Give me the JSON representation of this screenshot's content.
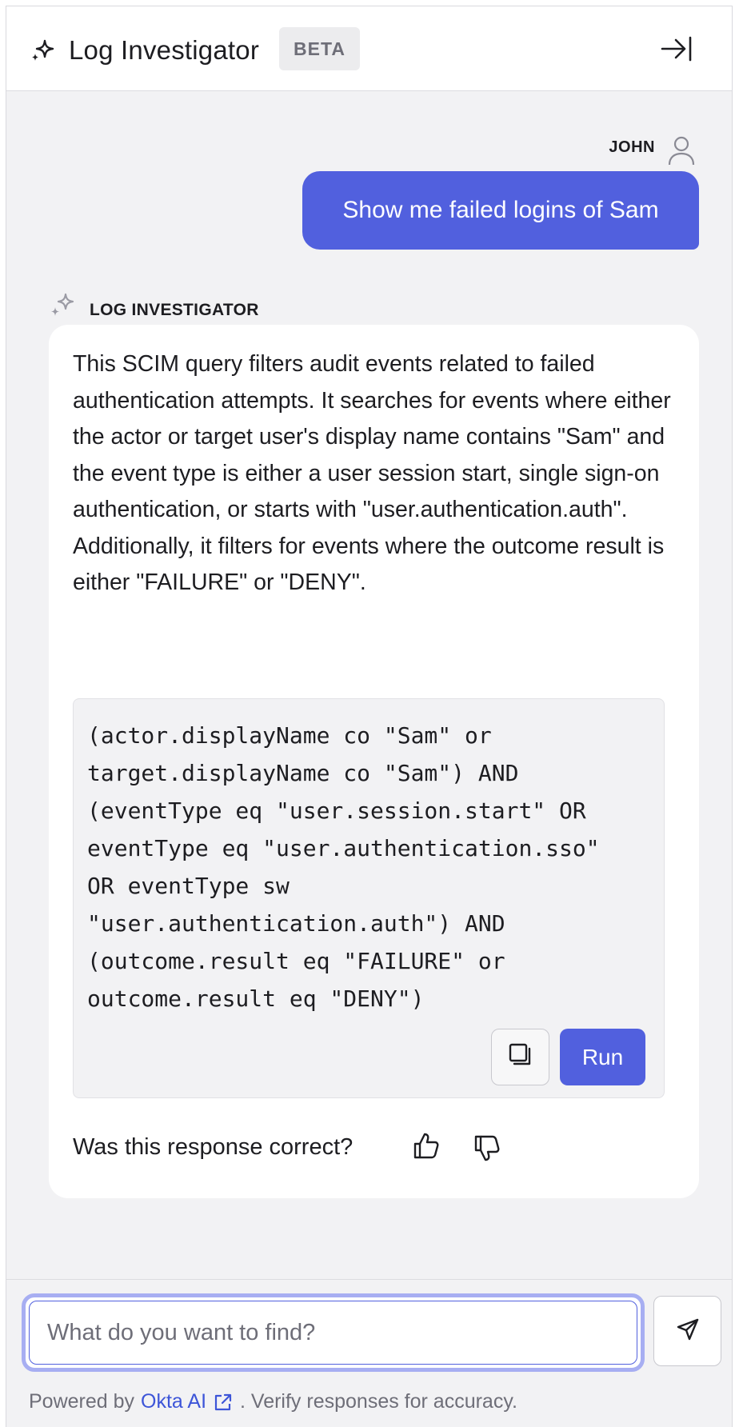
{
  "header": {
    "title": "Log Investigator",
    "badge": "BETA",
    "icons": {
      "logo": "sparkle-icon",
      "collapse": "collapse-panel-icon"
    }
  },
  "conversation": {
    "user": {
      "name": "JOHN",
      "avatar_icon": "user-avatar-icon",
      "message": "Show me failed logins of Sam"
    },
    "assistant": {
      "name": "LOG INVESTIGATOR",
      "avatar_icon": "sparkle-icon",
      "explanation": "This SCIM query filters audit events related to failed authentication attempts. It searches for events where either the actor or target user's display name contains \"Sam\" and the event type is either a user session start, single sign-on authentication, or starts with \"user.authentication.auth\". Additionally, it filters for events where the outcome result is either \"FAILURE\" or \"DENY\".",
      "query": "(actor.displayName co \"Sam\" or\ntarget.displayName co \"Sam\") AND\n(eventType eq \"user.session.start\" OR\neventType eq \"user.authentication.sso\"\nOR eventType sw\n\"user.authentication.auth\") AND\n(outcome.result eq \"FAILURE\" or\noutcome.result eq \"DENY\")",
      "copy_icon": "copy-icon",
      "run_label": "Run",
      "feedback_question": "Was this response correct?",
      "feedback_icons": [
        "thumbs-up-icon",
        "thumbs-down-icon"
      ]
    }
  },
  "composer": {
    "placeholder": "What do you want to find?",
    "value": "",
    "send_icon": "send-icon"
  },
  "footer": {
    "prefix": "Powered by",
    "link": "Okta AI",
    "suffix": ". Verify responses for accuracy.",
    "link_icon": "external-link-icon"
  },
  "colors": {
    "accent": "#5160de",
    "focus_ring": "#a7aef2",
    "panel_bg": "#f2f2f4",
    "link": "#3d55d8"
  }
}
